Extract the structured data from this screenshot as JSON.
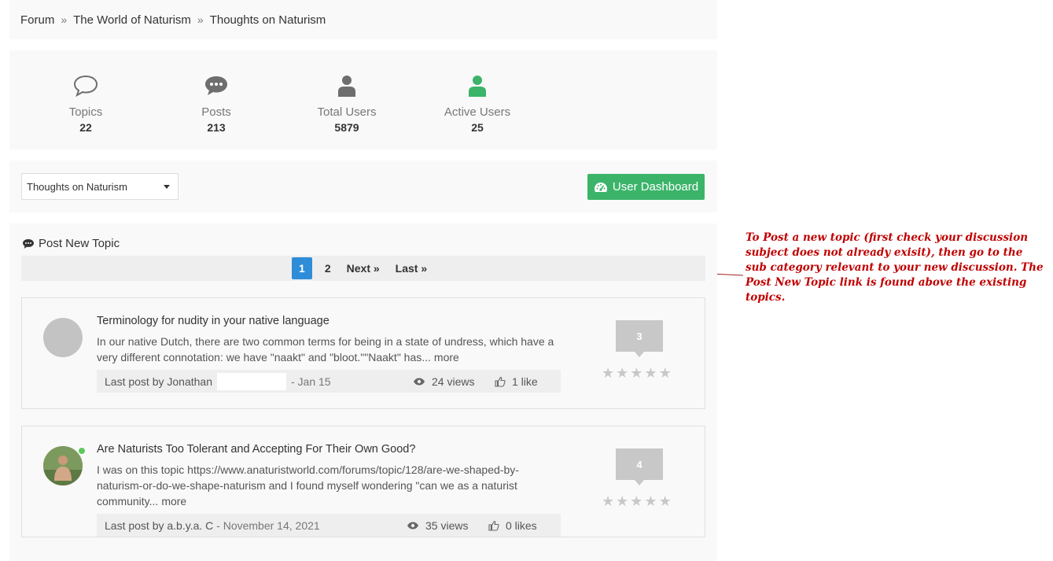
{
  "breadcrumb": {
    "items": [
      "Forum",
      "The World of Naturism",
      "Thoughts on Naturism"
    ],
    "separator": "»"
  },
  "stats": [
    {
      "label": "Topics",
      "value": "22",
      "icon": "speech-bubble-outline-icon"
    },
    {
      "label": "Posts",
      "value": "213",
      "icon": "speech-bubble-dots-icon"
    },
    {
      "label": "Total Users",
      "value": "5879",
      "icon": "user-icon"
    },
    {
      "label": "Active Users",
      "value": "25",
      "icon": "user-active-icon"
    }
  ],
  "controls": {
    "category_select": "Thoughts on Naturism",
    "dashboard_button": "User Dashboard"
  },
  "topics_header": {
    "post_new_label": "Post New Topic"
  },
  "pagination": {
    "pages": [
      "1",
      "2"
    ],
    "next": "Next »",
    "last": "Last »",
    "current": "1"
  },
  "topics": [
    {
      "title": "Terminology for nudity in your native language",
      "excerpt": "In our native Dutch, there are two common terms for being in a state of undress, which have a very different connotation: we have \"naakt\" and \"bloot.\"\"Naakt\" has...",
      "more": "more",
      "last_post_prefix": "Last post by Jonathan",
      "last_post_date": "- Jan 15",
      "views": "24 views",
      "likes": "1 like",
      "replies": "3"
    },
    {
      "title": "Are Naturists Too Tolerant and Accepting For Their Own Good?",
      "excerpt": "I was on this topic https://www.anaturistworld.com/forums/topic/128/are-we-shaped-by-naturism-or-do-we-shape-naturism and I found myself wondering \"can we as a naturist community...",
      "more": "more",
      "last_post_prefix": "Last post by a.b.y.a. C",
      "last_post_date": "- November 14, 2021",
      "views": "35 views",
      "likes": "0 likes",
      "replies": "4"
    }
  ],
  "annotation": {
    "text": "To Post a new topic (first check your discussion subject does not already exisit), then go to the sub category relevant to your new discussion. The Post New Topic link is found above the existing topics."
  },
  "colors": {
    "accent_green": "#3bb46a",
    "pager_blue": "#2f8cd9",
    "annotation_red": "#c00000",
    "icon_gray": "#6e6e6e"
  }
}
